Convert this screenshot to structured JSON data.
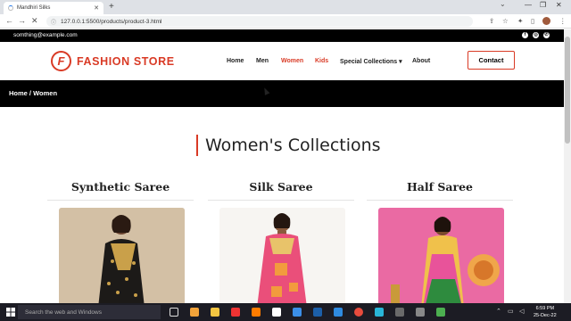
{
  "browser": {
    "tab_title": "Mandhiri Silks",
    "url": "127.0.0.1:5500/products/product-3.html"
  },
  "topbar": {
    "email": "somthing@example.com"
  },
  "header": {
    "logo_letter": "F",
    "brand": "FASHION STORE",
    "nav": [
      "Home",
      "Men",
      "Women",
      "Kids",
      "Special Collections",
      "About"
    ],
    "active": "Women",
    "contact": "Contact"
  },
  "breadcrumb": "Home / Women",
  "section_title": "Women's Collections",
  "products": [
    {
      "title": "Synthetic Saree"
    },
    {
      "title": "Silk Saree"
    },
    {
      "title": "Half Saree"
    }
  ],
  "taskbar": {
    "search_placeholder": "Search the web and Windows",
    "time": "6:59 PM",
    "date": "25-Dec-22"
  },
  "colors": {
    "accent": "#d93a25",
    "dark": "#000000"
  }
}
